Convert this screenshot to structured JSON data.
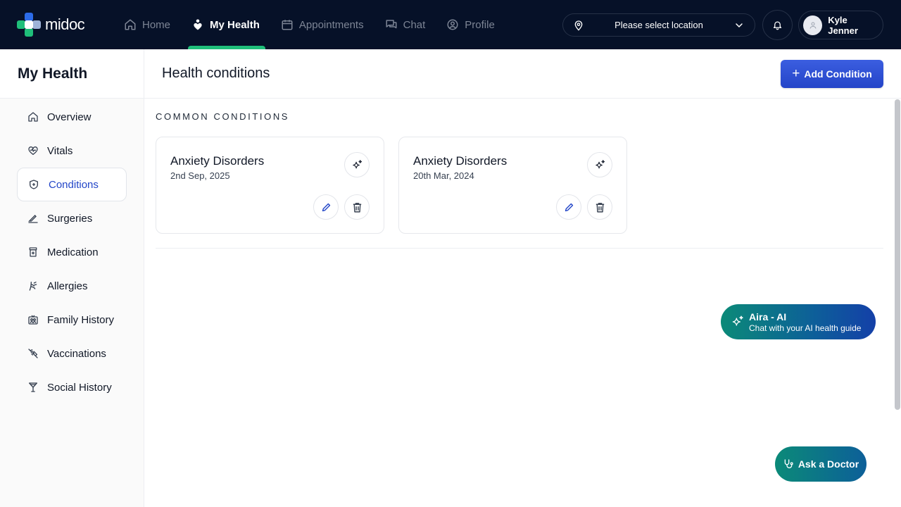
{
  "app": {
    "logo_text": "midoc",
    "brand_colors": [
      "#1fbf7a",
      "#2c6be8",
      "#9fb3d8"
    ]
  },
  "nav": {
    "items": [
      {
        "label": "Home",
        "icon": "home-icon",
        "active": false
      },
      {
        "label": "My Health",
        "icon": "heart-person-icon",
        "active": true
      },
      {
        "label": "Appointments",
        "icon": "calendar-icon",
        "active": false
      },
      {
        "label": "Chat",
        "icon": "chat-icon",
        "active": false
      },
      {
        "label": "Profile",
        "icon": "user-circle-icon",
        "active": false
      }
    ],
    "location_placeholder": "Please select location",
    "user_name": "Kyle Jenner"
  },
  "sidebar": {
    "title": "My Health",
    "items": [
      {
        "label": "Overview",
        "icon": "home-icon"
      },
      {
        "label": "Vitals",
        "icon": "heart-pulse-icon"
      },
      {
        "label": "Conditions",
        "icon": "shield-plus-icon"
      },
      {
        "label": "Surgeries",
        "icon": "scalpel-icon"
      },
      {
        "label": "Medication",
        "icon": "pill-bottle-icon"
      },
      {
        "label": "Allergies",
        "icon": "allergy-icon"
      },
      {
        "label": "Family History",
        "icon": "family-icon"
      },
      {
        "label": "Vaccinations",
        "icon": "syringe-icon"
      },
      {
        "label": "Social History",
        "icon": "cocktail-icon"
      }
    ],
    "active_index": 2
  },
  "main": {
    "title": "Health conditions",
    "add_button_label": "Add Condition",
    "section_label": "COMMON CONDITIONS",
    "conditions": [
      {
        "name": "Anxiety Disorders",
        "date": "2nd Sep, 2025"
      },
      {
        "name": "Anxiety Disorders",
        "date": "20th Mar, 2024"
      }
    ]
  },
  "assistant": {
    "title": "Aira - AI",
    "subtitle": "Chat with your AI health guide",
    "ask_doctor_label": "Ask a Doctor"
  },
  "colors": {
    "accent": "#2346c8",
    "nav_bg": "#061128",
    "active_indicator": "#1fbf7a",
    "teal": "#0b8a78"
  }
}
